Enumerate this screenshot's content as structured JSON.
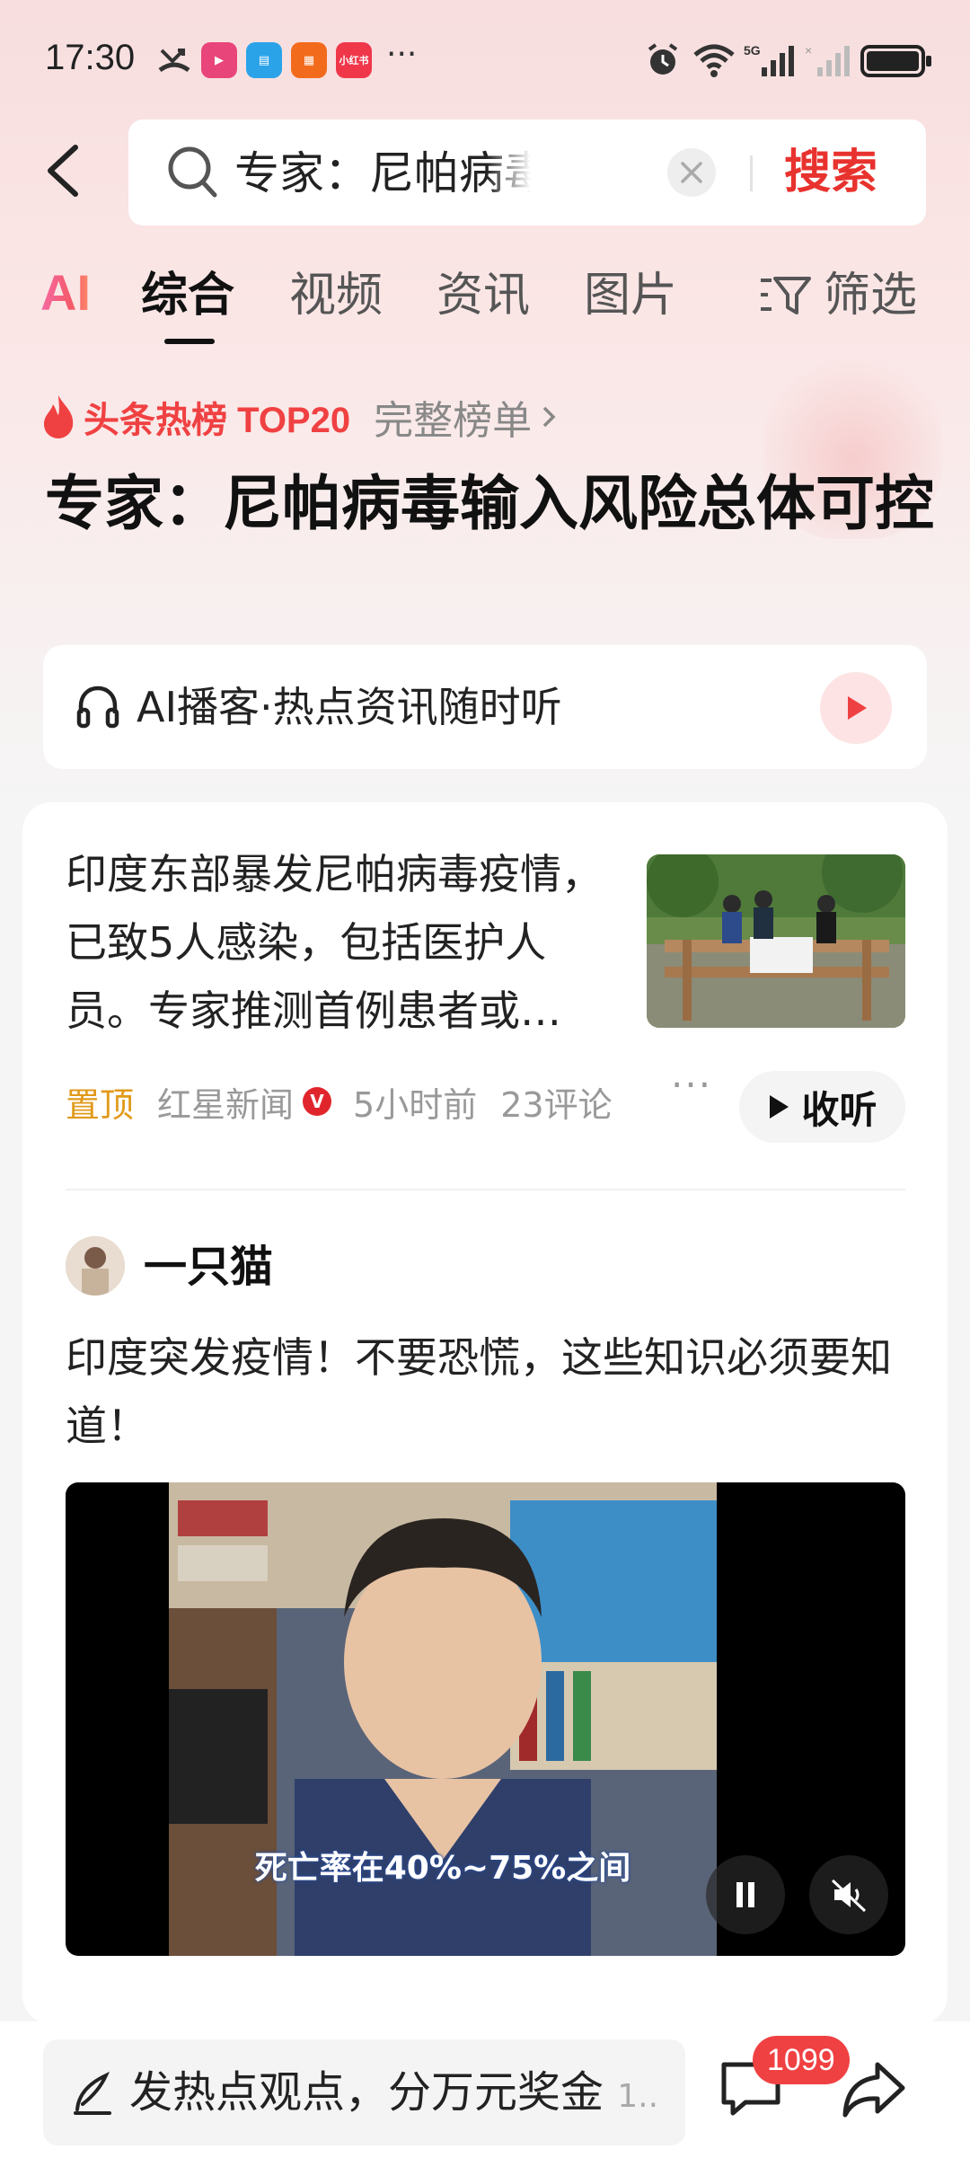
{
  "status_bar": {
    "time": "17:30",
    "app_icons": [
      {
        "name": "video-app-icon",
        "color": "#e8457a",
        "glyph": "▶"
      },
      {
        "name": "reader-app-icon",
        "color": "#2ba3e8",
        "glyph": "📖"
      },
      {
        "name": "orange-app-icon",
        "color": "#f26b1d",
        "glyph": "▦"
      },
      {
        "name": "xiaohongshu-app-icon",
        "color": "#f0374a",
        "glyph": "小红书"
      }
    ],
    "more": "···",
    "network": "5G"
  },
  "search": {
    "query": "专家：尼帕病毒输入风险总体可控",
    "submit_label": "搜索"
  },
  "tabs": {
    "ai_label": "AI",
    "items": [
      "综合",
      "视频",
      "资讯",
      "图片"
    ],
    "active": "综合",
    "filter_label": "筛选"
  },
  "hot": {
    "label": "头条热榜 TOP20",
    "full_list": "完整榜单",
    "title": "专家：尼帕病毒输入风险总体可控"
  },
  "podcast": {
    "label": "AI播客·热点资讯随时听"
  },
  "news": {
    "title": "印度东部暴发尼帕病毒疫情，已致5人感染，包括医护人员。专家推测首例患者或…",
    "pin": "置顶",
    "source": "红星新闻",
    "verified_mark": "V",
    "time": "5小时前",
    "comments": "23评论",
    "more": "···",
    "listen_label": "收听"
  },
  "post": {
    "author": "一只猫",
    "text": "印度突发疫情！不要恐慌，这些知识必须要知道！",
    "video_subtitle": "死亡率在40%~75%之间"
  },
  "bottom": {
    "comment_prompt": "发热点观点，分万元奖金",
    "comment_more": "1..",
    "comment_count": "1099"
  },
  "colors": {
    "accent_red": "#e8322e",
    "pin_orange": "#e19a1a"
  }
}
